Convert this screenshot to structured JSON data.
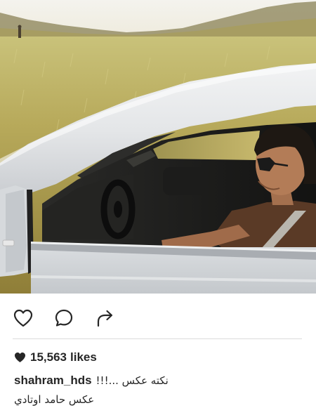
{
  "post": {
    "image_alt": "",
    "likes": {
      "count": "15,563",
      "label": "likes"
    },
    "caption": {
      "username": "shahram_hds",
      "text": "نکته عکس ...!!!",
      "credit": "عکس حامد اوتادي"
    }
  },
  "actions": {
    "like_icon": "heart-outline-icon",
    "comment_icon": "speech-bubble-icon",
    "share_icon": "share-arrow-icon"
  },
  "colors": {
    "text": "#262626",
    "divider": "#dbdbdb",
    "background": "#ffffff"
  }
}
